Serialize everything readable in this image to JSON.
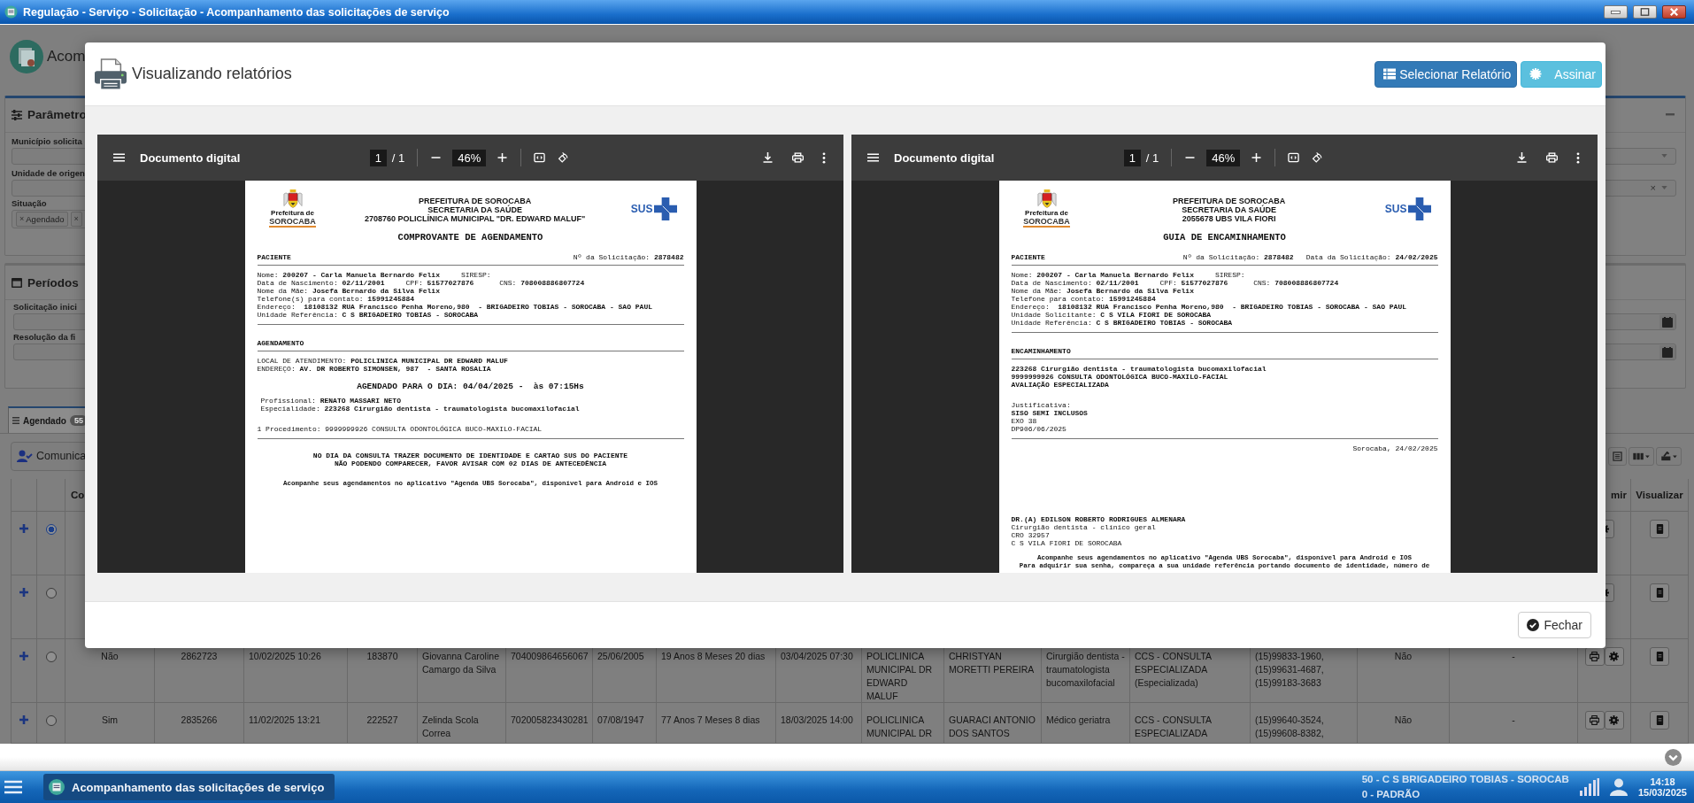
{
  "window": {
    "title": "Regulação - Serviço - Solicitação - Acompanhamento das solicitações de serviço"
  },
  "window_controls": [
    {
      "kind": "minimize"
    },
    {
      "kind": "maximize"
    },
    {
      "kind": "close"
    }
  ],
  "background": {
    "heading": "Acom",
    "parameters": {
      "title": "Parâmetro",
      "fields": [
        {
          "label": "Município solicita"
        },
        {
          "label": "Unidade de origen",
          "clear": "×"
        }
      ],
      "situation": {
        "label": "Situação",
        "tags": [
          {
            "remove": "×",
            "label": "Agendado"
          },
          {
            "remove": "×"
          }
        ]
      }
    },
    "periods": {
      "title": "Períodos",
      "fields": [
        {
          "label": "Solicitação inici"
        },
        {
          "label": "Resolução da fi"
        }
      ]
    },
    "tabs": [
      {
        "label": "Agendado",
        "count": "55",
        "selected": true
      }
    ],
    "toolbar": {
      "button": "Comunica"
    },
    "table": {
      "header": {
        "column_3": "Co",
        "column_19": "mir",
        "column_20": "Visualizar"
      },
      "rows": [
        {
          "selected": true
        },
        {
          "selected": false
        },
        {
          "selected": false,
          "cells": [
            "Não",
            "2862723",
            "10/02/2025 10:26",
            "183870",
            "Giovanna Caroline\nCamargo da Silva",
            "704009864656067",
            "25/06/2005",
            "19 Anos 8 Meses 20 dias",
            "03/04/2025 07:30",
            "POLICLINICA\nMUNICIPAL DR\nEDWARD\nMALUF",
            "CHRISTYAN\nMORETTI PEREIRA",
            "Cirurgião dentista -\ntraumatologista\nbucomaxilofacial",
            "CCS - CONSULTA\nESPECIALIZADA\n(Especializada)",
            "(15)99833-1960,\n(15)99631-4687,\n(15)99183-3683",
            "Não",
            "-"
          ]
        },
        {
          "selected": false,
          "cells": [
            "Sim",
            "2835266",
            "11/02/2025 13:21",
            "222527",
            "Zelinda Scola\nCorrea",
            "702005823430281",
            "07/08/1947",
            "77 Anos 7 Meses 8 dias",
            "18/03/2025 14:00",
            "POLICLINICA\nMUNICIPAL DR",
            "GUARACI ANTONIO\nDOS SANTOS",
            "Médico geriatra",
            "CCS - CONSULTA\nESPECIALIZADA",
            "(15)99640-3524,\n(15)99608-8382,",
            "Não",
            "-"
          ]
        }
      ]
    }
  },
  "dialog": {
    "title": "Visualizando relatórios",
    "buttons": [
      {
        "kind": "primary",
        "label": "Selecionar Relatório"
      },
      {
        "kind": "info",
        "label": "Assinar"
      }
    ],
    "viewers": [
      {
        "toolbar": {
          "title": "Documento digital",
          "page": "1",
          "page_count": "/ 1",
          "zoom": "46%"
        },
        "page": {
          "logo_text": [
            "Prefeitura de",
            "SOROCABA"
          ],
          "sus": "SUS",
          "header": [
            "PREFEITURA DE SOROCABA",
            "SECRETARIA DA SAÚDE",
            "2708760 POLICLÍNICA MUNICIPAL \"DR. EDWARD MALUF\""
          ],
          "title": "COMPROVANTE DE AGENDAMENTO",
          "blocks": [
            {
              "kind": "section",
              "label": "PACIENTE",
              "info": [
                "Nº da Solicitação: **2878482**"
              ]
            },
            {
              "kind": "rule"
            },
            {
              "kind": "lines",
              "lines": [
                "Nome: **200207 - Carla Manuela Bernardo Felix**     SIRESP:",
                "Data de Nascimento: **02/11/2001**     CPF: **51577027876**      CNS: **708008886807724**",
                "Nome da Mãe: **Josefa Bernardo da Silva Felix**",
                "Telefone(s) para contato: **15991245884**",
                "Endereço:  **18108132 RUA Francisco Penha Moreno,980  - BRIGADEIRO TOBIAS - SOROCABA - SAO PAUL**",
                "Unidade Referência: **C S BRIGADEIRO TOBIAS - SOROCABA**"
              ]
            },
            {
              "kind": "rule"
            },
            {
              "kind": "section",
              "label": "AGENDAMENTO"
            },
            {
              "kind": "rule"
            },
            {
              "kind": "lines",
              "lines": [
                "LOCAL DE ATENDIMENTO: **POLICLINICA MUNICIPAL DR EDWARD MALUF**",
                "ENDEREÇO: **AV. DR ROBERTO SIMONSEN, 987  - SANTA ROSALIA**"
              ]
            },
            {
              "kind": "highlight",
              "text": "AGENDADO PARA O DIA: 04/04/2025 -  às 07:15Hs"
            },
            {
              "kind": "detail",
              "lines": [
                "Profissional: **RENATO MASSARI NETO**",
                "Especialidade: **223268 Cirurgião dentista - traumatologista bucomaxilofacial**"
              ]
            },
            {
              "kind": "lines",
              "lines": [
                "1 Procedimento: 9999999926 CONSULTA ODONTOLÓGICA BUCO-MAXILO-FACIAL"
              ]
            },
            {
              "kind": "rule"
            },
            {
              "kind": "notice",
              "lines": [
                "NO DIA DA CONSULTA TRAZER DOCUMENTO DE IDENTIDADE E CARTAO SUS DO PACIENTE",
                "NÃO PODENDO COMPARECER, FAVOR AVISAR COM 02 DIAS DE ANTECEDÊNCIA"
              ]
            },
            {
              "kind": "footer",
              "lines": [
                "Acompanhe seus agendamentos no aplicativo \"Agenda UBS Sorocaba\", disponível para Android e IOS"
              ]
            }
          ]
        }
      },
      {
        "toolbar": {
          "title": "Documento digital",
          "page": "1",
          "page_count": "/ 1",
          "zoom": "46%"
        },
        "page": {
          "logo_text": [
            "Prefeitura de",
            "SOROCABA"
          ],
          "sus": "SUS",
          "header": [
            "PREFEITURA DE SOROCABA",
            "SECRETARIA DA SAÚDE",
            "2055678 UBS VILA FIORI"
          ],
          "title": "GUIA DE ENCAMINHAMENTO",
          "blocks": [
            {
              "kind": "section",
              "label": "PACIENTE",
              "info": [
                "Nº da Solicitação: **2878482**",
                "Data da Solicitação: **24/02/2025**"
              ]
            },
            {
              "kind": "rule"
            },
            {
              "kind": "lines",
              "lines": [
                "Nome: **200207 - Carla Manuela Bernardo Felix**     SIRESP:",
                "Data de Nascimento: **02/11/2001**     CPF: **51577027876**      CNS: **708008886807724**",
                "Nome da Mãe: **Josefa Bernardo da Silva Felix**",
                "Telefone para contato: **15991245884**",
                "Endereço:  **18108132 RUA Francisco Penha Moreno,980  - BRIGADEIRO TOBIAS - SOROCABA - SAO PAUL**",
                "Unidade Solicitante: **C S VILA FIORI DE SOROCABA**",
                "Unidade Referência: **C S BRIGADEIRO TOBIAS - SOROCABA**"
              ]
            },
            {
              "kind": "rule"
            },
            {
              "kind": "section",
              "label": "ENCAMINHAMENTO"
            },
            {
              "kind": "rule"
            },
            {
              "kind": "lines",
              "lines": [
                "**223268 Cirurgião dentista - traumatologista bucomaxilofacial**",
                "**9999999926 CONSULTA ODONTOLÓGICA BUCO-MAXILO-FACIAL**",
                "**AVALIAÇÃO ESPECIALIZADA**"
              ]
            },
            {
              "kind": "lines",
              "lines": [
                "Justificativa:",
                "**SISO SEMI INCLUSOS**",
                "EXO 38",
                "DP906/06/2025"
              ]
            },
            {
              "kind": "rule"
            },
            {
              "kind": "right",
              "text": "Sorocaba, 24/02/2025"
            },
            {
              "kind": "signature",
              "lines": [
                "**DR.(A) EDILSON ROBERTO RODRIGUES ALMENARA**",
                "Cirurgião dentista - clínico geral",
                "CRO 32957",
                "C S VILA FIORI DE SOROCABA"
              ]
            },
            {
              "kind": "footer",
              "lines": [
                "Acompanhe seus agendamentos no aplicativo \"Agenda UBS Sorocaba\", disponível para Android e IOS",
                "Para adquirir sua senha, compareça a sua unidade referência portando documento de identidade, número de"
              ]
            }
          ]
        }
      }
    ],
    "close_button": "Fechar"
  },
  "taskbar": {
    "task": "Acompanhamento das solicitações de serviço",
    "unit": "50 - C S BRIGADEIRO TOBIAS - SOROCAB",
    "profile": "0 - PADRÃO",
    "time": "14:18",
    "date": "15/03/2025"
  }
}
